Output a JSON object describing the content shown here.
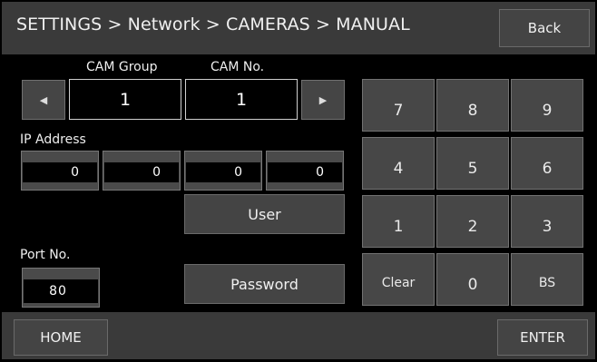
{
  "header": {
    "title": "SETTINGS > Network > CAMERAS > MANUAL",
    "back_label": "Back"
  },
  "camera": {
    "group_label": "CAM Group",
    "group_value": "1",
    "number_label": "CAM No.",
    "number_value": "1",
    "prev_icon": "triangle-left-icon",
    "next_icon": "triangle-right-icon"
  },
  "ip": {
    "label": "IP Address",
    "octets": [
      "0",
      "0",
      "0",
      "0"
    ]
  },
  "user_label": "User",
  "password_label": "Password",
  "port": {
    "label": "Port No.",
    "value": "80"
  },
  "keypad": {
    "keys": [
      "7",
      "8",
      "9",
      "4",
      "5",
      "6",
      "1",
      "2",
      "3",
      "Clear",
      "0",
      "BS"
    ]
  },
  "footer": {
    "home_label": "HOME",
    "enter_label": "ENTER"
  },
  "colors": {
    "background": "#000000",
    "panel": "#3a3a3a",
    "button": "#454545",
    "border": "#707070",
    "text": "#f0f0f0"
  }
}
